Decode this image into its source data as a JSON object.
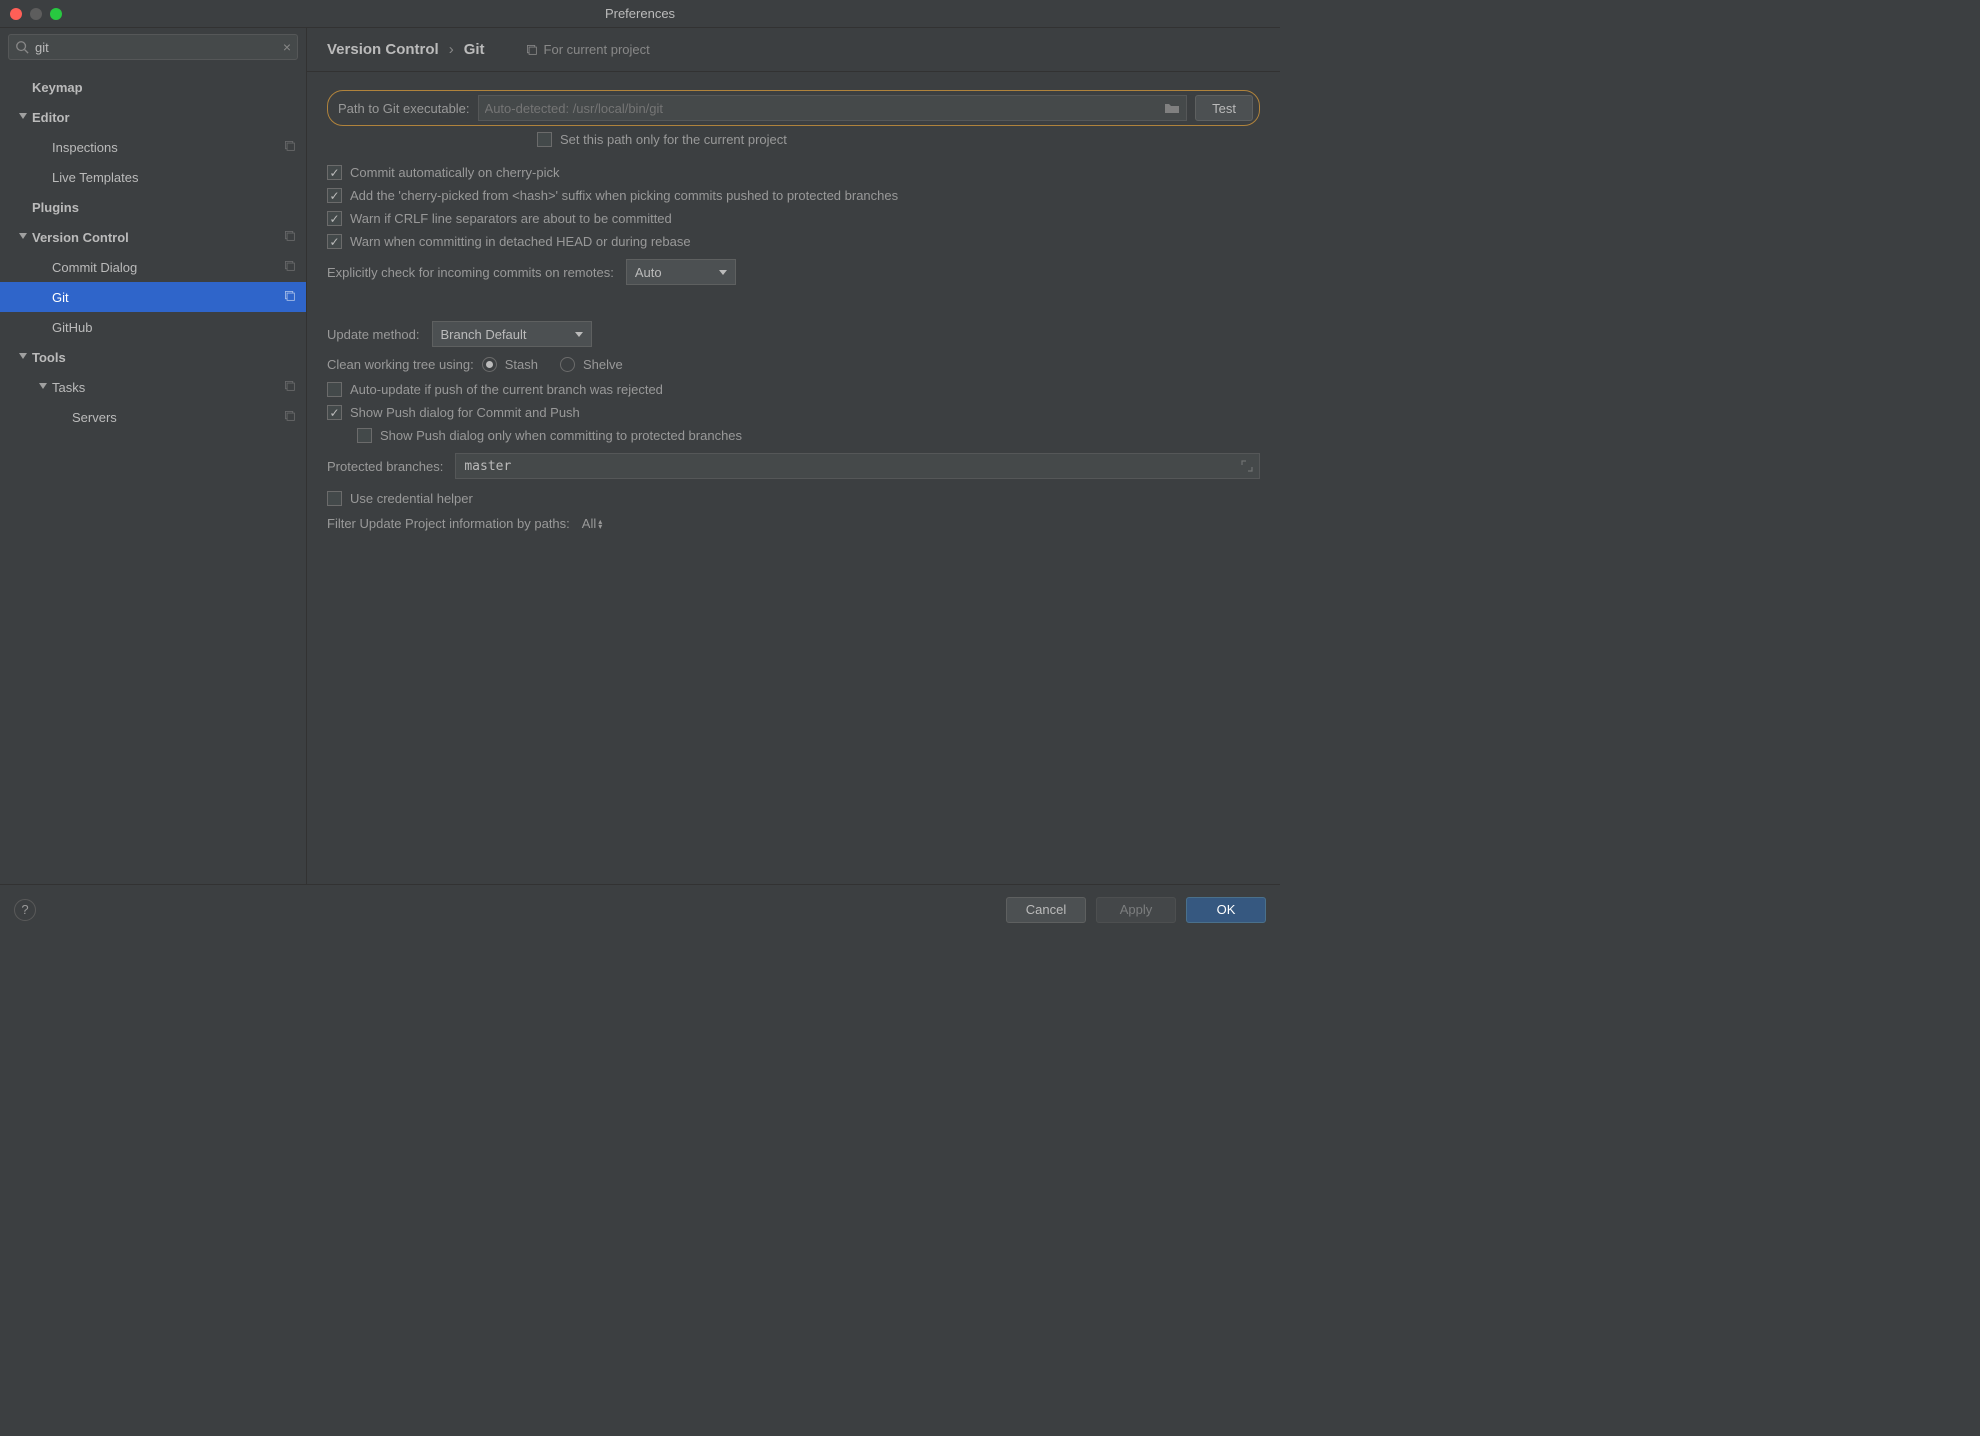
{
  "title": "Preferences",
  "search": {
    "value": "git",
    "placeholder": ""
  },
  "tree": [
    {
      "label": "Keymap",
      "depth": 1,
      "bold": true,
      "leaf": true
    },
    {
      "label": "Editor",
      "depth": 1,
      "bold": true,
      "leaf": false
    },
    {
      "label": "Inspections",
      "depth": 2,
      "bold": false,
      "leaf": true,
      "scope": true
    },
    {
      "label": "Live Templates",
      "depth": 2,
      "bold": false,
      "leaf": true
    },
    {
      "label": "Plugins",
      "depth": 1,
      "bold": true,
      "leaf": true
    },
    {
      "label": "Version Control",
      "depth": 1,
      "bold": true,
      "leaf": false,
      "scope": true
    },
    {
      "label": "Commit Dialog",
      "depth": 2,
      "bold": false,
      "leaf": true,
      "scope": true
    },
    {
      "label": "Git",
      "depth": 2,
      "bold": false,
      "leaf": true,
      "scope": true,
      "selected": true
    },
    {
      "label": "GitHub",
      "depth": 2,
      "bold": false,
      "leaf": true
    },
    {
      "label": "Tools",
      "depth": 1,
      "bold": true,
      "leaf": false
    },
    {
      "label": "Tasks",
      "depth": 2,
      "bold": false,
      "leaf": false,
      "scope": true
    },
    {
      "label": "Servers",
      "depth": 3,
      "bold": false,
      "leaf": true,
      "scope": true
    }
  ],
  "breadcrumb": {
    "a": "Version Control",
    "b": "Git"
  },
  "project_hint": "For current project",
  "path": {
    "label": "Path to Git executable:",
    "placeholder": "Auto-detected: /usr/local/bin/git",
    "value": "",
    "test": "Test",
    "subcheck": "Set this path only for the current project",
    "subcheck_checked": false
  },
  "checks": [
    {
      "label": "Commit automatically on cherry-pick",
      "checked": true
    },
    {
      "label": "Add the 'cherry-picked from <hash>' suffix when picking commits pushed to protected branches",
      "checked": true
    },
    {
      "label": "Warn if CRLF line separators are about to be committed",
      "checked": true
    },
    {
      "label": "Warn when committing in detached HEAD or during rebase",
      "checked": true
    }
  ],
  "remotes": {
    "label": "Explicitly check for incoming commits on remotes:",
    "value": "Auto"
  },
  "update": {
    "label": "Update method:",
    "value": "Branch Default"
  },
  "clean": {
    "label": "Clean working tree using:",
    "opt1": "Stash",
    "opt2": "Shelve",
    "selected": "Stash"
  },
  "push": {
    "auto_update": {
      "label": "Auto-update if push of the current branch was rejected",
      "checked": false
    },
    "show_push": {
      "label": "Show Push dialog for Commit and Push",
      "checked": true
    },
    "show_push_protected": {
      "label": "Show Push dialog only when committing to protected branches",
      "checked": false
    }
  },
  "protected": {
    "label": "Protected branches:",
    "value": "master"
  },
  "credential": {
    "label": "Use credential helper",
    "checked": false
  },
  "filter": {
    "label": "Filter Update Project information by paths:",
    "value": "All"
  },
  "footer": {
    "cancel": "Cancel",
    "apply": "Apply",
    "ok": "OK"
  }
}
